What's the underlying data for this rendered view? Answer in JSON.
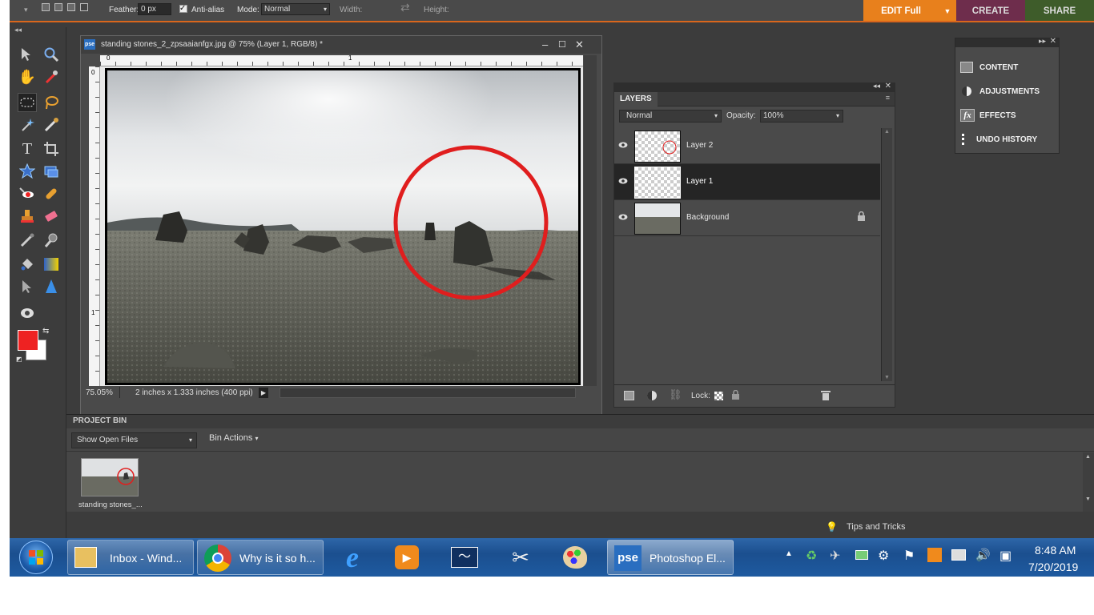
{
  "options_bar": {
    "feather_label": "Feather:",
    "feather_value": "0 px",
    "antialias_label": "Anti-alias",
    "mode_label": "Mode:",
    "mode_value": "Normal",
    "width_label": "Width:",
    "height_label": "Height:"
  },
  "mode_tabs": {
    "edit": "EDIT Full",
    "create": "CREATE",
    "share": "SHARE"
  },
  "colors": {
    "edit_tab": "#e8801c",
    "create_tab": "#6e2d4c",
    "share_tab": "#3e5c2a",
    "foreground": "#ee2222",
    "background": "#ffffff",
    "selected_layer": "#252525",
    "circle": "#e01e1e",
    "accent_line": "#d9661c"
  },
  "tools": [
    "move-icon",
    "zoom-icon",
    "hand-icon",
    "eyedropper-icon",
    "marquee-icon",
    "lasso-icon",
    "magic-wand-icon",
    "selection-brush-icon",
    "type-icon",
    "crop-icon",
    "cookie-cutter-icon",
    "straighten-icon",
    "red-eye-icon",
    "healing-icon",
    "clone-stamp-icon",
    "eraser-icon",
    "brush-icon",
    "smart-brush-icon",
    "paint-bucket-icon",
    "gradient-icon",
    "shape-select-icon",
    "sharpen-icon",
    "camera-icon"
  ],
  "document": {
    "title": "standing stones_2_zpsaaianfgx.jpg @ 75% (Layer 1, RGB/8) *",
    "ruler_zero": "0",
    "ruler_one": "1",
    "ruler_v_zero": "0",
    "ruler_v_one": "1",
    "zoom": "75.05%",
    "size_info": "2 inches x 1.333 inches (400 ppi)"
  },
  "layers_panel": {
    "title": "LAYERS",
    "blend_mode": "Normal",
    "opacity_label": "Opacity:",
    "opacity_value": "100%",
    "lock_label": "Lock:",
    "layers": [
      {
        "name": "Layer 2",
        "selected": false
      },
      {
        "name": "Layer 1",
        "selected": true
      },
      {
        "name": "Background",
        "selected": false,
        "locked": true
      }
    ]
  },
  "right_panel": {
    "items": [
      "CONTENT",
      "ADJUSTMENTS",
      "EFFECTS",
      "UNDO HISTORY"
    ]
  },
  "project_bin": {
    "title": "PROJECT BIN",
    "show_select": "Show Open Files",
    "bin_actions": "Bin Actions",
    "file_label": "standing stones_..."
  },
  "tips": "Tips and Tricks",
  "taskbar": {
    "buttons": [
      {
        "label": "Inbox - Wind..."
      },
      {
        "label": "Why is it so h..."
      },
      {
        "label": "Photoshop El..."
      }
    ],
    "pse_badge": "pse",
    "time": "8:48 AM",
    "date": "7/20/2019"
  }
}
